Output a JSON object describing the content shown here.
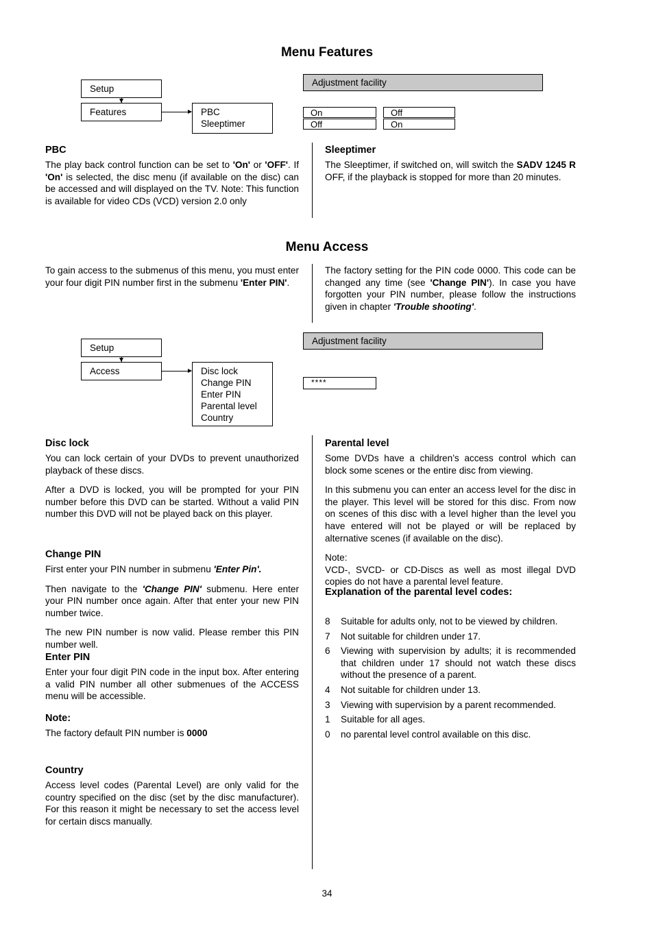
{
  "page": {
    "number": "34"
  },
  "features_section": {
    "title": "Menu Features",
    "diagram": {
      "setup_box": "Setup",
      "menu_box": "Features",
      "submenu_items": [
        "PBC",
        "Sleeptimer"
      ],
      "adjustment_header": "Adjustment facility",
      "option_rows": [
        {
          "left": "On",
          "right": "Off"
        },
        {
          "left": "Off",
          "right": "On"
        }
      ]
    },
    "pbc": {
      "heading": "PBC",
      "paragraph_html": "The play back control function can be set to <b>'On'</b> or <b>'OFF'</b>. If <b>'On'</b> is selected, the disc menu (if available on the disc) can be accessed and will displayed on the TV. Note: This function is available for video CDs (VCD) version 2.0 only"
    },
    "sleeptimer": {
      "heading": "Sleeptimer",
      "paragraph_html": "The Sleeptimer, if switched on, will switch the <b>SADV 1245 R</b> OFF, if the playback is stopped for more than 20 minutes."
    }
  },
  "access_section": {
    "title": "Menu Access",
    "intro_left_html": "To gain access to the submenus of this menu, you must enter your four digit PIN number first in the submenu <b>'Enter PIN'</b>.",
    "intro_right_html": "The factory setting for the PIN code 0000. This code can be changed any time (see <b>'Change PIN'</b>). In case you have forgotten your PIN number, please follow the instructions given in chapter <i class=\"bi\">'Trouble shooting'</i>.",
    "diagram": {
      "setup_box": "Setup",
      "menu_box": "Access",
      "submenu_items": [
        "Disc lock",
        "Change PIN",
        "Enter PIN",
        "Parental level",
        "Country"
      ],
      "adjustment_header": "Adjustment facility",
      "pin_input_value": "****"
    },
    "disc_lock": {
      "heading": "Disc lock",
      "paragraphs_html": [
        "You can lock certain of your DVDs to prevent unauthorized playback of these discs.",
        "After a DVD is locked, you will be prompted for your PIN number before this DVD can be started. Without a valid PIN number this DVD will not be played back on this player."
      ]
    },
    "change_pin": {
      "heading": "Change PIN",
      "paragraphs_html": [
        "First enter your PIN number in submenu <i class=\"bi\">'Enter Pin'.</i>",
        "Then navigate to the <i class=\"bi\">'Change PIN'</i> submenu. Here enter your PIN number once again. After that enter your new PIN number twice.",
        "The new PIN number is now valid. Please rember this PIN number well."
      ]
    },
    "enter_pin": {
      "heading": "Enter PIN",
      "paragraph_html": "Enter your four digit PIN code in the input box. After entering a valid PIN number all other submenues of the ACCESS menu will be accessible.",
      "note_heading": "Note:",
      "note_html": "The factory default PIN number is <b>0000</b>"
    },
    "country": {
      "heading": "Country",
      "paragraph_html": "Access level codes (Parental Level) are only valid for the country specified on the disc (set by the disc manufacturer). For this reason it might be necessary to set the access level for certain discs manually."
    },
    "parental_level": {
      "heading": "Parental level",
      "paragraphs_html": [
        "Some DVDs have a children’s access control which can block some scenes or the entire disc from viewing.",
        "In this submenu you can enter an access level for the disc in the player. This level will be stored for this disc. From now on scenes of this disc with a level higher than the level you have entered will not be played or will be replaced by alternative scenes (if available on the disc)."
      ],
      "note_label": "Note:",
      "note_html": "VCD-, SVCD- or CD-Discs as well as most illegal DVD copies do not have a parental level feature."
    },
    "codes": {
      "heading": "Explanation of the parental level codes:",
      "items": [
        {
          "code": "8",
          "text": "Suitable for adults only, not to be viewed by children."
        },
        {
          "code": "7",
          "text": "Not suitable for children under 17."
        },
        {
          "code": "6",
          "text": "Viewing with supervision by adults; it is recommended that children under 17 should not watch these discs without the presence of a parent."
        },
        {
          "code": "4",
          "text": "Not suitable for children under 13."
        },
        {
          "code": "3",
          "text": "Viewing with supervision by a parent recommended."
        },
        {
          "code": "1",
          "text": "Suitable for all ages."
        },
        {
          "code": "0",
          "text": "no parental level control available on this disc."
        }
      ]
    }
  }
}
